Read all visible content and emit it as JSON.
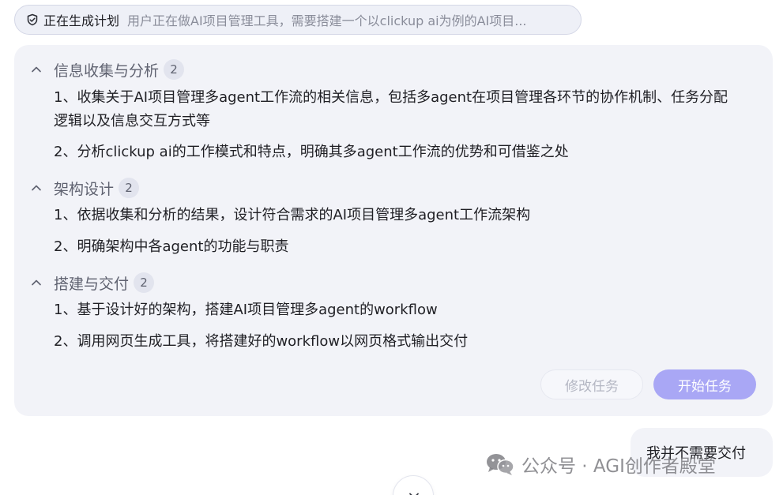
{
  "status": {
    "title": "正在生成计划",
    "description": "用户正在做AI项目管理工具，需要搭建一个以clickup ai为例的AI项目..."
  },
  "plan": {
    "sections": [
      {
        "title": "信息收集与分析",
        "count": "2",
        "items": [
          "1、收集关于AI项目管理多agent工作流的相关信息，包括多agent在项目管理各环节的协作机制、任务分配逻辑以及信息交互方式等",
          "2、分析clickup ai的工作模式和特点，明确其多agent工作流的优势和可借鉴之处"
        ]
      },
      {
        "title": "架构设计",
        "count": "2",
        "items": [
          "1、依据收集和分析的结果，设计符合需求的AI项目管理多agent工作流架构",
          "2、明确架构中各agent的功能与职责"
        ]
      },
      {
        "title": "搭建与交付",
        "count": "2",
        "items": [
          "1、基于设计好的架构，搭建AI项目管理多agent的workflow",
          "2、调用网页生成工具，将搭建好的workflow以网页格式输出交付"
        ]
      }
    ],
    "edit_label": "修改任务",
    "start_label": "开始任务"
  },
  "user_message": "我并不需要交付",
  "watermark": "公众号 · AGI创作者殿堂",
  "colors": {
    "accent": "#a9a7f5",
    "card_bg": "#f2f3f8",
    "muted_text": "#8a8d9a"
  },
  "icons": {
    "status": "check-shield-icon",
    "section_toggle": "chevron-up-icon",
    "scroll": "chevron-down-icon",
    "watermark": "wechat-icon"
  }
}
